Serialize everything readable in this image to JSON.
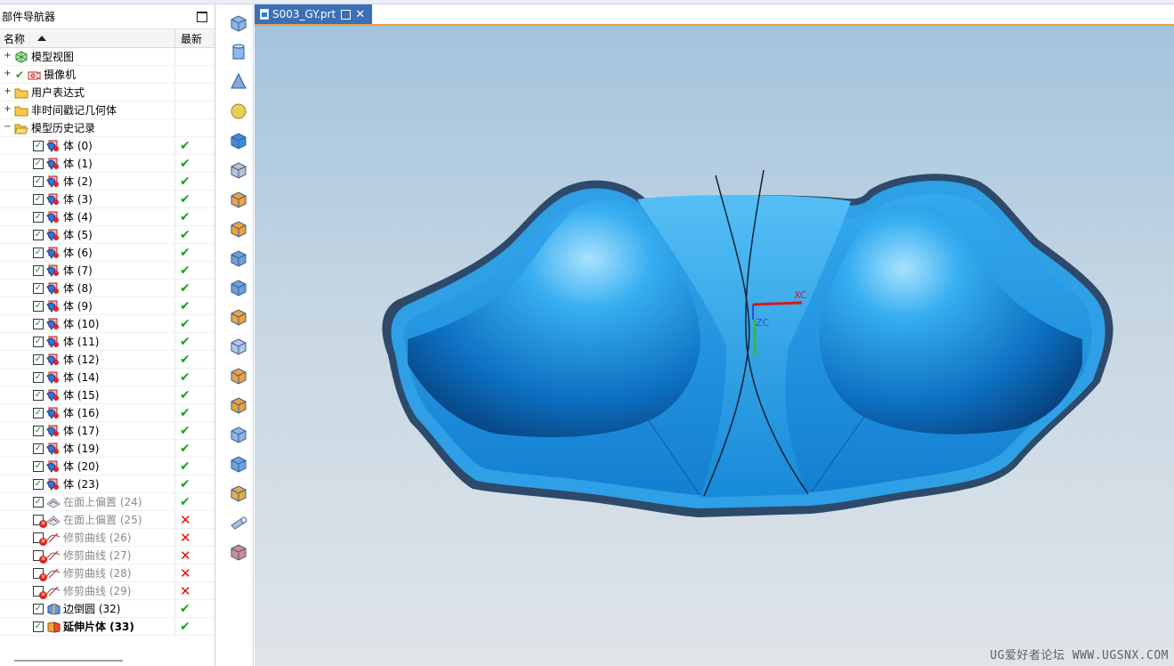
{
  "navigator": {
    "title": "部件导航器",
    "col_name": "名称",
    "col_latest": "最新",
    "tree": [
      {
        "label": "模型视图",
        "expander": "+",
        "indent": 1,
        "icon": "model-view-icon",
        "state": "none",
        "latest": ""
      },
      {
        "label": "摄像机",
        "expander": "+",
        "indent": 1,
        "icon": "camera-icon",
        "state": "camera",
        "latest": ""
      },
      {
        "label": "用户表达式",
        "expander": "+",
        "indent": 1,
        "icon": "folder-icon",
        "state": "none",
        "latest": ""
      },
      {
        "label": "非时间戳记几何体",
        "expander": "+",
        "indent": 1,
        "icon": "folder-icon",
        "state": "none",
        "latest": ""
      },
      {
        "label": "模型历史记录",
        "expander": "−",
        "indent": 1,
        "icon": "folder-open-icon",
        "state": "none",
        "latest": ""
      },
      {
        "label": "体 (0)",
        "indent": 2,
        "icon": "body-icon",
        "state": "on",
        "latest": "ok"
      },
      {
        "label": "体 (1)",
        "indent": 2,
        "icon": "body-icon",
        "state": "on",
        "latest": "ok"
      },
      {
        "label": "体 (2)",
        "indent": 2,
        "icon": "body-icon",
        "state": "on",
        "latest": "ok"
      },
      {
        "label": "体 (3)",
        "indent": 2,
        "icon": "body-icon",
        "state": "on",
        "latest": "ok"
      },
      {
        "label": "体 (4)",
        "indent": 2,
        "icon": "body-icon",
        "state": "on",
        "latest": "ok"
      },
      {
        "label": "体 (5)",
        "indent": 2,
        "icon": "body-icon",
        "state": "on",
        "latest": "ok"
      },
      {
        "label": "体 (6)",
        "indent": 2,
        "icon": "body-icon",
        "state": "on",
        "latest": "ok"
      },
      {
        "label": "体 (7)",
        "indent": 2,
        "icon": "body-icon",
        "state": "on",
        "latest": "ok"
      },
      {
        "label": "体 (8)",
        "indent": 2,
        "icon": "body-icon",
        "state": "on",
        "latest": "ok"
      },
      {
        "label": "体 (9)",
        "indent": 2,
        "icon": "body-icon",
        "state": "on",
        "latest": "ok"
      },
      {
        "label": "体 (10)",
        "indent": 2,
        "icon": "body-icon",
        "state": "on",
        "latest": "ok"
      },
      {
        "label": "体 (11)",
        "indent": 2,
        "icon": "body-icon",
        "state": "on",
        "latest": "ok"
      },
      {
        "label": "体 (12)",
        "indent": 2,
        "icon": "body-icon",
        "state": "on",
        "latest": "ok"
      },
      {
        "label": "体 (14)",
        "indent": 2,
        "icon": "body-icon",
        "state": "on",
        "latest": "ok"
      },
      {
        "label": "体 (15)",
        "indent": 2,
        "icon": "body-icon",
        "state": "on",
        "latest": "ok"
      },
      {
        "label": "体 (16)",
        "indent": 2,
        "icon": "body-icon",
        "state": "on",
        "latest": "ok"
      },
      {
        "label": "体 (17)",
        "indent": 2,
        "icon": "body-icon",
        "state": "on",
        "latest": "ok"
      },
      {
        "label": "体 (19)",
        "indent": 2,
        "icon": "body-icon",
        "state": "on",
        "latest": "ok"
      },
      {
        "label": "体 (20)",
        "indent": 2,
        "icon": "body-icon",
        "state": "on",
        "latest": "ok"
      },
      {
        "label": "体 (23)",
        "indent": 2,
        "icon": "body-icon",
        "state": "on",
        "latest": "ok"
      },
      {
        "label": "在面上偏置 (24)",
        "indent": 2,
        "icon": "offset-in-face-icon",
        "state": "on",
        "latest": "ok",
        "style": "grey"
      },
      {
        "label": "在面上偏置 (25)",
        "indent": 2,
        "icon": "offset-in-face-icon",
        "state": "off",
        "latest": "fail",
        "style": "grey"
      },
      {
        "label": "修剪曲线 (26)",
        "indent": 2,
        "icon": "trim-curve-icon",
        "state": "off",
        "latest": "fail",
        "style": "grey"
      },
      {
        "label": "修剪曲线 (27)",
        "indent": 2,
        "icon": "trim-curve-icon",
        "state": "off",
        "latest": "fail",
        "style": "grey"
      },
      {
        "label": "修剪曲线 (28)",
        "indent": 2,
        "icon": "trim-curve-icon",
        "state": "off",
        "latest": "fail",
        "style": "grey"
      },
      {
        "label": "修剪曲线 (29)",
        "indent": 2,
        "icon": "trim-curve-icon",
        "state": "off",
        "latest": "fail",
        "style": "grey"
      },
      {
        "label": "边倒圆 (32)",
        "indent": 2,
        "icon": "edge-blend-icon",
        "state": "on",
        "latest": "ok"
      },
      {
        "label": "延伸片体 (33)",
        "indent": 2,
        "icon": "extend-sheet-icon",
        "state": "on",
        "latest": "ok",
        "style": "bold"
      }
    ]
  },
  "tab": {
    "title": "S003_GY.prt"
  },
  "viewport": {
    "axis_x": "XC",
    "axis_z": "ZC",
    "watermark": "UG爱好者论坛 WWW.UGSNX.COM"
  },
  "toolbar": [
    "block-icon",
    "cylinder-icon",
    "cone-icon",
    "sphere-icon",
    "boss-icon",
    "thread-icon",
    "pattern-feature-icon",
    "unite-icon",
    "extrude-sheet-icon",
    "swept-icon",
    "shell-icon",
    "offset-face-icon",
    "draft-icon",
    "thicken-icon",
    "trim-body-icon",
    "split-body-icon",
    "emboss-icon",
    "tube-icon",
    "mesh-surface-icon"
  ],
  "colors": {
    "accent_tab": "#3c6fb6",
    "tab_underline": "#e8a14a",
    "part_blue": "#1b8fd8",
    "ok_green": "#1ca21c",
    "fail_red": "#e3120b"
  }
}
